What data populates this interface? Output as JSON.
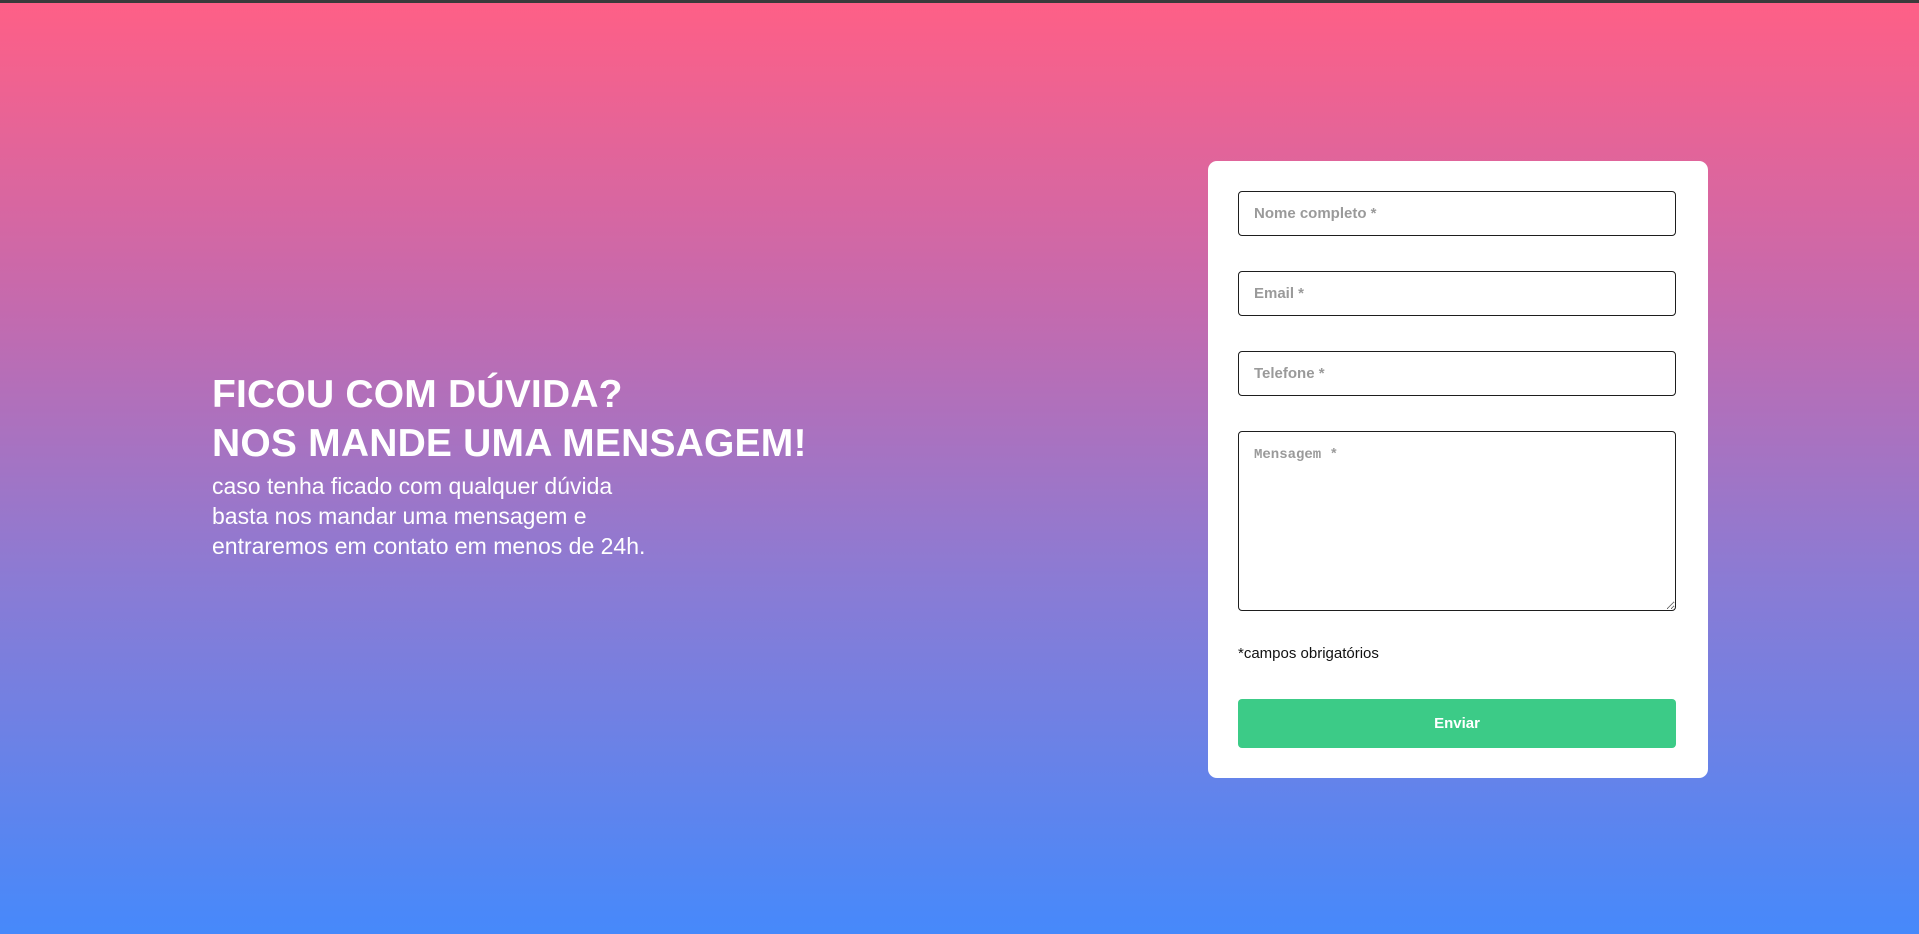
{
  "colors": {
    "gradient_top": "#ff5f86",
    "gradient_bottom": "#4689fb",
    "button": "#3ccb87",
    "card": "#ffffff"
  },
  "intro": {
    "heading_lines": [
      "FICOU COM DÚVIDA?",
      "NOS MANDE UMA MENSAGEM!"
    ],
    "description_lines": [
      "caso tenha ficado com qualquer dúvida",
      "basta nos mandar uma mensagem e",
      "entraremos em contato em menos de 24h."
    ]
  },
  "form": {
    "name_placeholder": "Nome completo *",
    "name_value": "",
    "email_placeholder": "Email *",
    "email_value": "",
    "phone_placeholder": "Telefone *",
    "phone_value": "",
    "message_placeholder": "Mensagem *",
    "message_value": "",
    "required_note": "*campos obrigatórios",
    "submit_label": "Enviar"
  }
}
